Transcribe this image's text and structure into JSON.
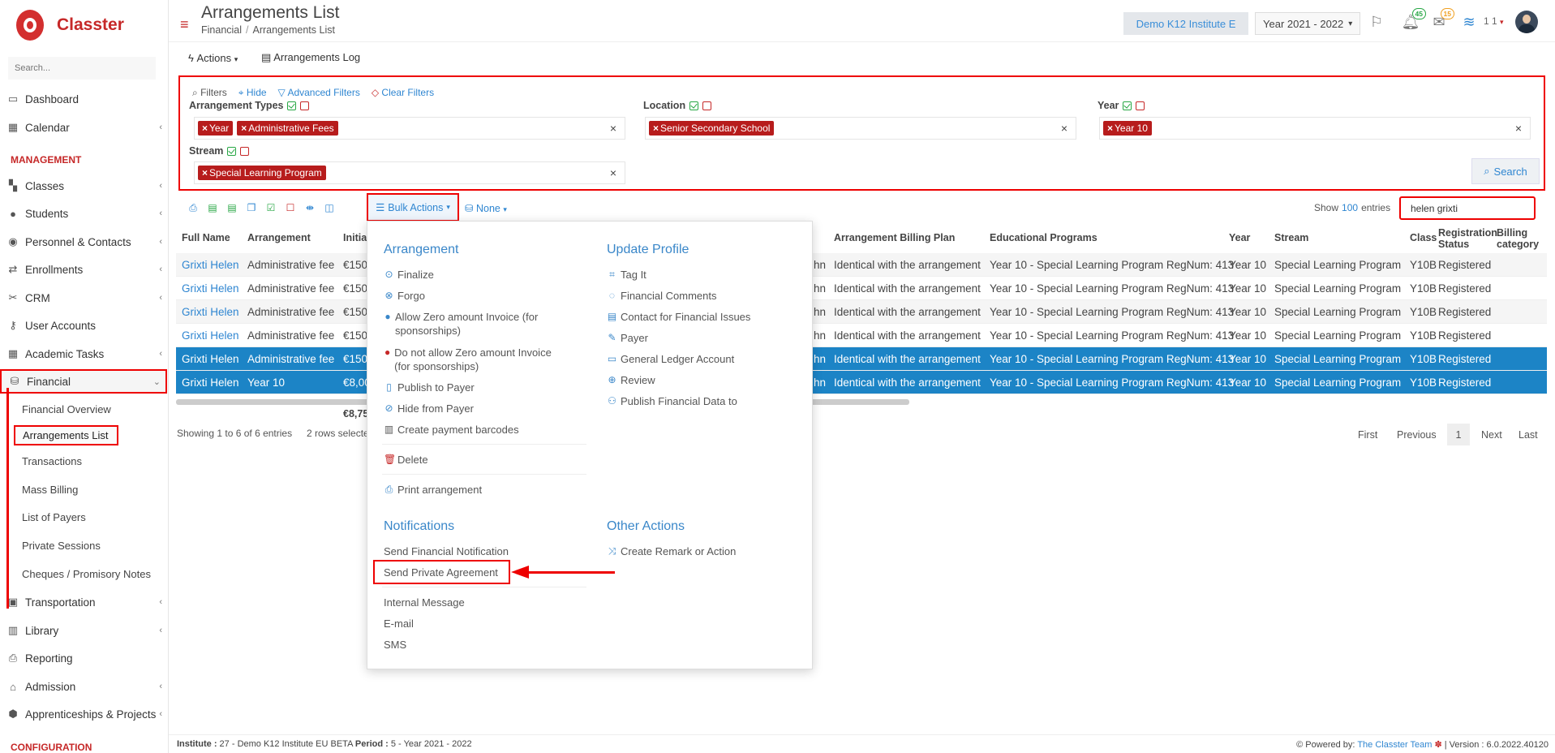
{
  "app": {
    "name": "Classter",
    "search_placeholder": "Search..."
  },
  "sidebar": {
    "items": [
      {
        "label": "Dashboard",
        "icon": "monitor-icon"
      },
      {
        "label": "Calendar",
        "icon": "calendar-icon"
      },
      {
        "label": "Classes",
        "icon": "classes-icon"
      },
      {
        "label": "Students",
        "icon": "students-icon"
      },
      {
        "label": "Personnel & Contacts",
        "icon": "person-icon"
      },
      {
        "label": "Enrollments",
        "icon": "swap-icon"
      },
      {
        "label": "CRM",
        "icon": "crm-icon"
      },
      {
        "label": "User Accounts",
        "icon": "key-icon"
      },
      {
        "label": "Academic Tasks",
        "icon": "grid-icon"
      },
      {
        "label": "Financial",
        "icon": "coins-icon"
      },
      {
        "label": "Transportation",
        "icon": "bus-icon"
      },
      {
        "label": "Library",
        "icon": "books-icon"
      },
      {
        "label": "Reporting",
        "icon": "printer-icon"
      },
      {
        "label": "Admission",
        "icon": "bank-icon"
      },
      {
        "label": "Apprenticeships & Projects",
        "icon": "cube-icon"
      }
    ],
    "section_management": "MANAGEMENT",
    "section_configuration": "CONFIGURATION",
    "financial_sub": [
      "Financial Overview",
      "Arrangements List",
      "Transactions",
      "Mass Billing",
      "List of Payers",
      "Private Sessions",
      "Cheques / Promisory Notes"
    ]
  },
  "header": {
    "title": "Arrangements List",
    "breadcrumb": [
      "Financial",
      "Arrangements List"
    ],
    "institute": "Demo K12 Institute E",
    "year": "Year 2021 - 2022",
    "badge_alerts": "45",
    "badge_messages": "15",
    "user_num": "1 1"
  },
  "toolbar": {
    "actions": "Actions",
    "log": "Arrangements Log"
  },
  "filters": {
    "label": "Filters",
    "hide": "Hide",
    "advanced": "Advanced Filters",
    "clear": "Clear Filters",
    "arrangement_types": {
      "name": "Arrangement Types",
      "tags": [
        "Year",
        "Administrative Fees"
      ]
    },
    "location": {
      "name": "Location",
      "tags": [
        "Senior Secondary School"
      ]
    },
    "year": {
      "name": "Year",
      "tags": [
        "Year 10"
      ]
    },
    "stream": {
      "name": "Stream",
      "tags": [
        "Special Learning Program"
      ]
    },
    "search_label": "Search"
  },
  "table_controls": {
    "bulk_actions": "Bulk Actions",
    "none": "None",
    "show": "Show",
    "entries_count": "100",
    "entries": "entries",
    "search_value": "helen grixti"
  },
  "table": {
    "headers": {
      "full_name": "Full Name",
      "arrangement": "Arrangement",
      "initial": "Initia",
      "billing_plan": "Arrangement Billing Plan",
      "programs": "Educational Programs",
      "year": "Year",
      "stream": "Stream",
      "class": "Class",
      "reg_status_1": "Registration",
      "reg_status_2": "Status",
      "billing_cat_1": "Billing",
      "billing_cat_2": "category"
    },
    "rows": [
      {
        "name": "Grixti Helen",
        "arrangement": "Administrative fee",
        "initial": "€150",
        "trunc": "hn",
        "plan": "Identical with the arrangement",
        "program": "Year 10 - Special Learning Program RegNum: 413",
        "year": "Year 10",
        "stream": "Special Learning Program",
        "class": "Y10B",
        "status": "Registered"
      },
      {
        "name": "Grixti Helen",
        "arrangement": "Administrative fee",
        "initial": "€150",
        "trunc": "hn",
        "plan": "Identical with the arrangement",
        "program": "Year 10 - Special Learning Program RegNum: 413",
        "year": "Year 10",
        "stream": "Special Learning Program",
        "class": "Y10B",
        "status": "Registered"
      },
      {
        "name": "Grixti Helen",
        "arrangement": "Administrative fee",
        "initial": "€150",
        "trunc": "hn",
        "plan": "Identical with the arrangement",
        "program": "Year 10 - Special Learning Program RegNum: 413",
        "year": "Year 10",
        "stream": "Special Learning Program",
        "class": "Y10B",
        "status": "Registered"
      },
      {
        "name": "Grixti Helen",
        "arrangement": "Administrative fee",
        "initial": "€150",
        "trunc": "hn",
        "plan": "Identical with the arrangement",
        "program": "Year 10 - Special Learning Program RegNum: 413",
        "year": "Year 10",
        "stream": "Special Learning Program",
        "class": "Y10B",
        "status": "Registered"
      },
      {
        "name": "Grixti Helen",
        "arrangement": "Administrative fee",
        "initial": "€150",
        "trunc": "hn",
        "plan": "Identical with the arrangement",
        "program": "Year 10 - Special Learning Program RegNum: 413",
        "year": "Year 10",
        "stream": "Special Learning Program",
        "class": "Y10B",
        "status": "Registered"
      },
      {
        "name": "Grixti Helen",
        "arrangement": "Year 10",
        "initial": "€8,00",
        "trunc": "hn",
        "plan": "Identical with the arrangement",
        "program": "Year 10 - Special Learning Program RegNum: 413",
        "year": "Year 10",
        "stream": "Special Learning Program",
        "class": "Y10B",
        "status": "Registered"
      }
    ],
    "total": "€8,75",
    "showing": "Showing 1 to 6 of 6 entries",
    "rows_selected": "2 rows selecte",
    "pager": {
      "first": "First",
      "previous": "Previous",
      "page": "1",
      "next": "Next",
      "last": "Last"
    }
  },
  "dropdown": {
    "arrangement_title": "Arrangement",
    "update_title": "Update Profile",
    "notifications_title": "Notifications",
    "other_title": "Other Actions",
    "arrangement_items": [
      "Finalize",
      "Forgo",
      "Allow Zero amount Invoice (for sponsorships)",
      "Do not allow Zero amount Invoice (for sponsorships)",
      "Publish to Payer",
      "Hide from Payer",
      "Create payment barcodes",
      "Delete",
      "Print arrangement"
    ],
    "update_items": [
      "Tag It",
      "Financial Comments",
      "Contact for Financial Issues",
      "Payer",
      "General Ledger Account",
      "Review",
      "Publish Financial Data to"
    ],
    "notification_items": [
      "Send Financial Notification",
      "Send Private Agreement",
      "Internal Message",
      "E-mail",
      "SMS"
    ],
    "other_items": [
      "Create Remark or Action"
    ]
  },
  "footer": {
    "institute_label": "Institute :",
    "institute_value": " 27 - Demo K12 Institute EU BETA ",
    "period_label": "Period :",
    "period_value": " 5 - Year 2021 - 2022",
    "powered": "Powered by: ",
    "team": "The Classter Team",
    "version": " | Version : 6.0.2022.40120"
  }
}
